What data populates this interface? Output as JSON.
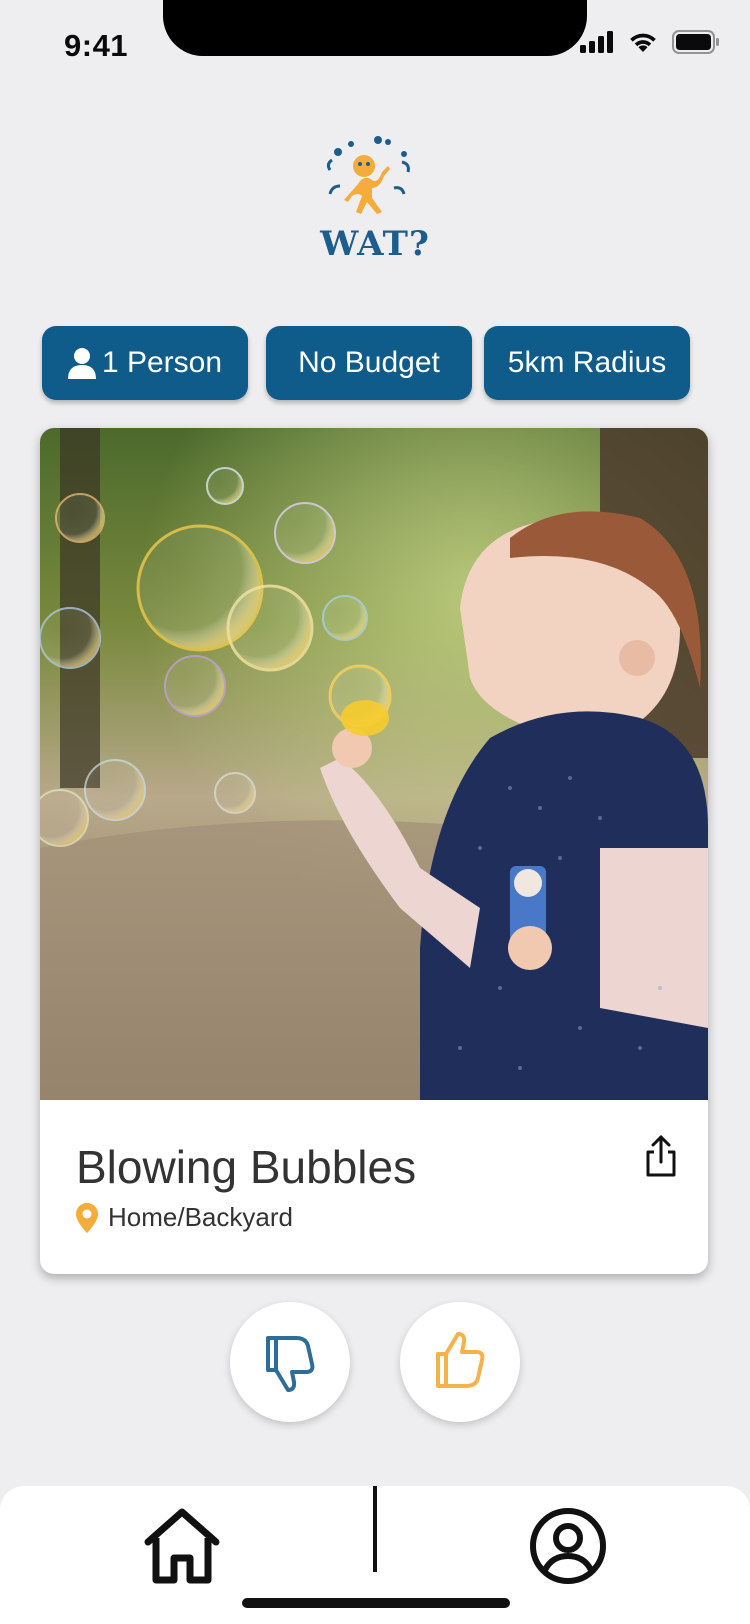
{
  "status_bar": {
    "time": "9:41"
  },
  "app": {
    "logo_text": "WAT?"
  },
  "filters": {
    "people": "1 Person",
    "budget": "No Budget",
    "radius": "5km Radius"
  },
  "card": {
    "title": "Blowing Bubbles",
    "location": "Home/Backyard"
  },
  "icons": {
    "person": "person-icon",
    "pin": "location-pin-icon",
    "share": "share-icon",
    "dislike": "thumbs-down-icon",
    "like": "thumbs-up-icon",
    "home": "home-icon",
    "profile": "profile-icon"
  },
  "colors": {
    "primary": "#0F5C8A",
    "accent": "#F5AC3A",
    "background": "#EEEEF0",
    "dislike": "#2E6D96",
    "like": "#F5B24A"
  }
}
